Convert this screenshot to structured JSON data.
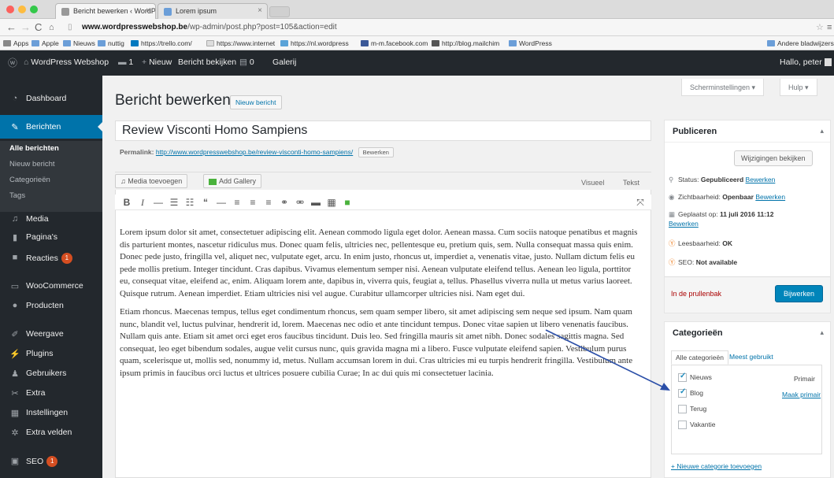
{
  "browser": {
    "tabs": [
      {
        "title": "Bericht bewerken ‹ WordP",
        "active": true
      },
      {
        "title": "Lorem ipsum",
        "active": false
      }
    ],
    "url_host": "www.wordpresswebshop.be",
    "url_path": "/wp-admin/post.php?post=105&action=edit",
    "bookmarks": [
      {
        "label": "Apps",
        "icon": "apps-grid"
      },
      {
        "label": "Apple",
        "icon": "folder"
      },
      {
        "label": "Nieuws",
        "icon": "folder"
      },
      {
        "label": "nuttig",
        "icon": "folder"
      },
      {
        "label": "https://trello.com/",
        "icon": "page"
      },
      {
        "label": "https://www.internet",
        "icon": "page"
      },
      {
        "label": "https://nl.wordpress",
        "icon": "page"
      },
      {
        "label": "m-m.facebook.com",
        "icon": "facebook"
      },
      {
        "label": "http://blog.mailchim",
        "icon": "page"
      },
      {
        "label": "WordPress",
        "icon": "folder"
      }
    ],
    "other_bookmarks": "Andere bladwijzers"
  },
  "adminbar": {
    "site_name": "WordPress Webshop",
    "comments_count": "1",
    "new_label": "Nieuw",
    "view_post": "Bericht bekijken",
    "wc_count": "0",
    "gallery": "Galerij",
    "greeting": "Hallo, peter"
  },
  "sidebar": {
    "items": [
      {
        "label": "Dashboard",
        "icon": "dashboard-icon"
      },
      {
        "label": "Berichten",
        "icon": "pin-icon"
      },
      {
        "label": "Media",
        "icon": "media-icon"
      },
      {
        "label": "Pagina's",
        "icon": "page-icon"
      },
      {
        "label": "Reacties",
        "icon": "comment-icon",
        "badge": "1"
      },
      {
        "label": "WooCommerce",
        "icon": "woo-icon"
      },
      {
        "label": "Producten",
        "icon": "box-icon"
      },
      {
        "label": "Weergave",
        "icon": "brush-icon"
      },
      {
        "label": "Plugins",
        "icon": "plug-icon"
      },
      {
        "label": "Gebruikers",
        "icon": "users-icon"
      },
      {
        "label": "Extra",
        "icon": "wrench-icon"
      },
      {
        "label": "Instellingen",
        "icon": "settings-icon"
      },
      {
        "label": "Extra velden",
        "icon": "gear-icon"
      },
      {
        "label": "SEO",
        "icon": "seo-icon",
        "badge": "1"
      }
    ],
    "submenu": [
      "Alle berichten",
      "Nieuw bericht",
      "Categorieën",
      "Tags"
    ]
  },
  "header": {
    "title": "Bericht bewerken",
    "new_post": "Nieuw bericht",
    "screen_options": "Scherminstellingen ▾",
    "help": "Hulp ▾"
  },
  "post": {
    "title": "Review Visconti Homo Sampiens",
    "permalink_label": "Permalink:",
    "permalink_url": "http://www.wordpresswebshop.be/review-visconti-homo-sampiens/",
    "edit_permalink": "Bewerken",
    "add_media": "Media toevoegen",
    "add_gallery": "Add Gallery",
    "tab_visual": "Visueel",
    "tab_text": "Tekst",
    "paragraphs": [
      "Lorem ipsum dolor sit amet, consectetuer adipiscing elit. Aenean commodo ligula eget dolor. Aenean massa. Cum sociis natoque penatibus et magnis dis parturient montes, nascetur ridiculus mus. Donec quam felis, ultricies nec, pellentesque eu, pretium quis, sem. Nulla consequat massa quis enim. Donec pede justo, fringilla vel, aliquet nec, vulputate eget, arcu. In enim justo, rhoncus ut, imperdiet a, venenatis vitae, justo. Nullam dictum felis eu pede mollis pretium. Integer tincidunt. Cras dapibus. Vivamus elementum semper nisi. Aenean vulputate eleifend tellus. Aenean leo ligula, porttitor eu, consequat vitae, eleifend ac, enim. Aliquam lorem ante, dapibus in, viverra quis, feugiat a, tellus. Phasellus viverra nulla ut metus varius laoreet. Quisque rutrum. Aenean imperdiet. Etiam ultricies nisi vel augue. Curabitur ullamcorper ultricies nisi. Nam eget dui.",
      "Etiam rhoncus. Maecenas tempus, tellus eget condimentum rhoncus, sem quam semper libero, sit amet adipiscing sem neque sed ipsum. Nam quam nunc, blandit vel, luctus pulvinar, hendrerit id, lorem. Maecenas nec odio et ante tincidunt tempus. Donec vitae sapien ut libero venenatis faucibus. Nullam quis ante. Etiam sit amet orci eget eros faucibus tincidunt. Duis leo. Sed fringilla mauris sit amet nibh. Donec sodales sagittis magna. Sed consequat, leo eget bibendum sodales, augue velit cursus nunc, quis gravida magna mi a libero. Fusce vulputate eleifend sapien. Vestibulum purus quam, scelerisque ut, mollis sed, nonummy id, metus. Nullam accumsan lorem in dui. Cras ultricies mi eu turpis hendrerit fringilla. Vestibulum ante ipsum primis in faucibus orci luctus et ultrices posuere cubilia Curae; In ac dui quis mi consectetuer lacinia."
    ]
  },
  "publish": {
    "heading": "Publiceren",
    "preview_changes": "Wijzigingen bekijken",
    "status_label": "Status:",
    "status_value": "Gepubliceerd",
    "visibility_label": "Zichtbaarheid:",
    "visibility_value": "Openbaar",
    "published_label": "Geplaatst op:",
    "published_value": "11 juli 2016 11:12",
    "edit": "Bewerken",
    "readability_label": "Leesbaarheid:",
    "readability_value": "OK",
    "seo_label": "SEO:",
    "seo_value": "Not available",
    "trash": "In de prullenbak",
    "update": "Bijwerken"
  },
  "categories": {
    "heading": "Categorieën",
    "tab_all": "Alle categorieën",
    "tab_popular": "Meest gebruikt",
    "items": [
      {
        "label": "Nieuws",
        "checked": true
      },
      {
        "label": "Blog",
        "checked": true
      },
      {
        "label": "Terug",
        "checked": false
      },
      {
        "label": "Vakantie",
        "checked": false
      }
    ],
    "primary_label": "Primair",
    "make_primary": "Maak primair",
    "add_new": "+ Nieuwe categorie toevoegen"
  },
  "colors": {
    "admin_dark": "#23282d",
    "accent": "#0073aa",
    "primary_button": "#0085ba",
    "annotation_arrow": "#2b4fa8"
  }
}
